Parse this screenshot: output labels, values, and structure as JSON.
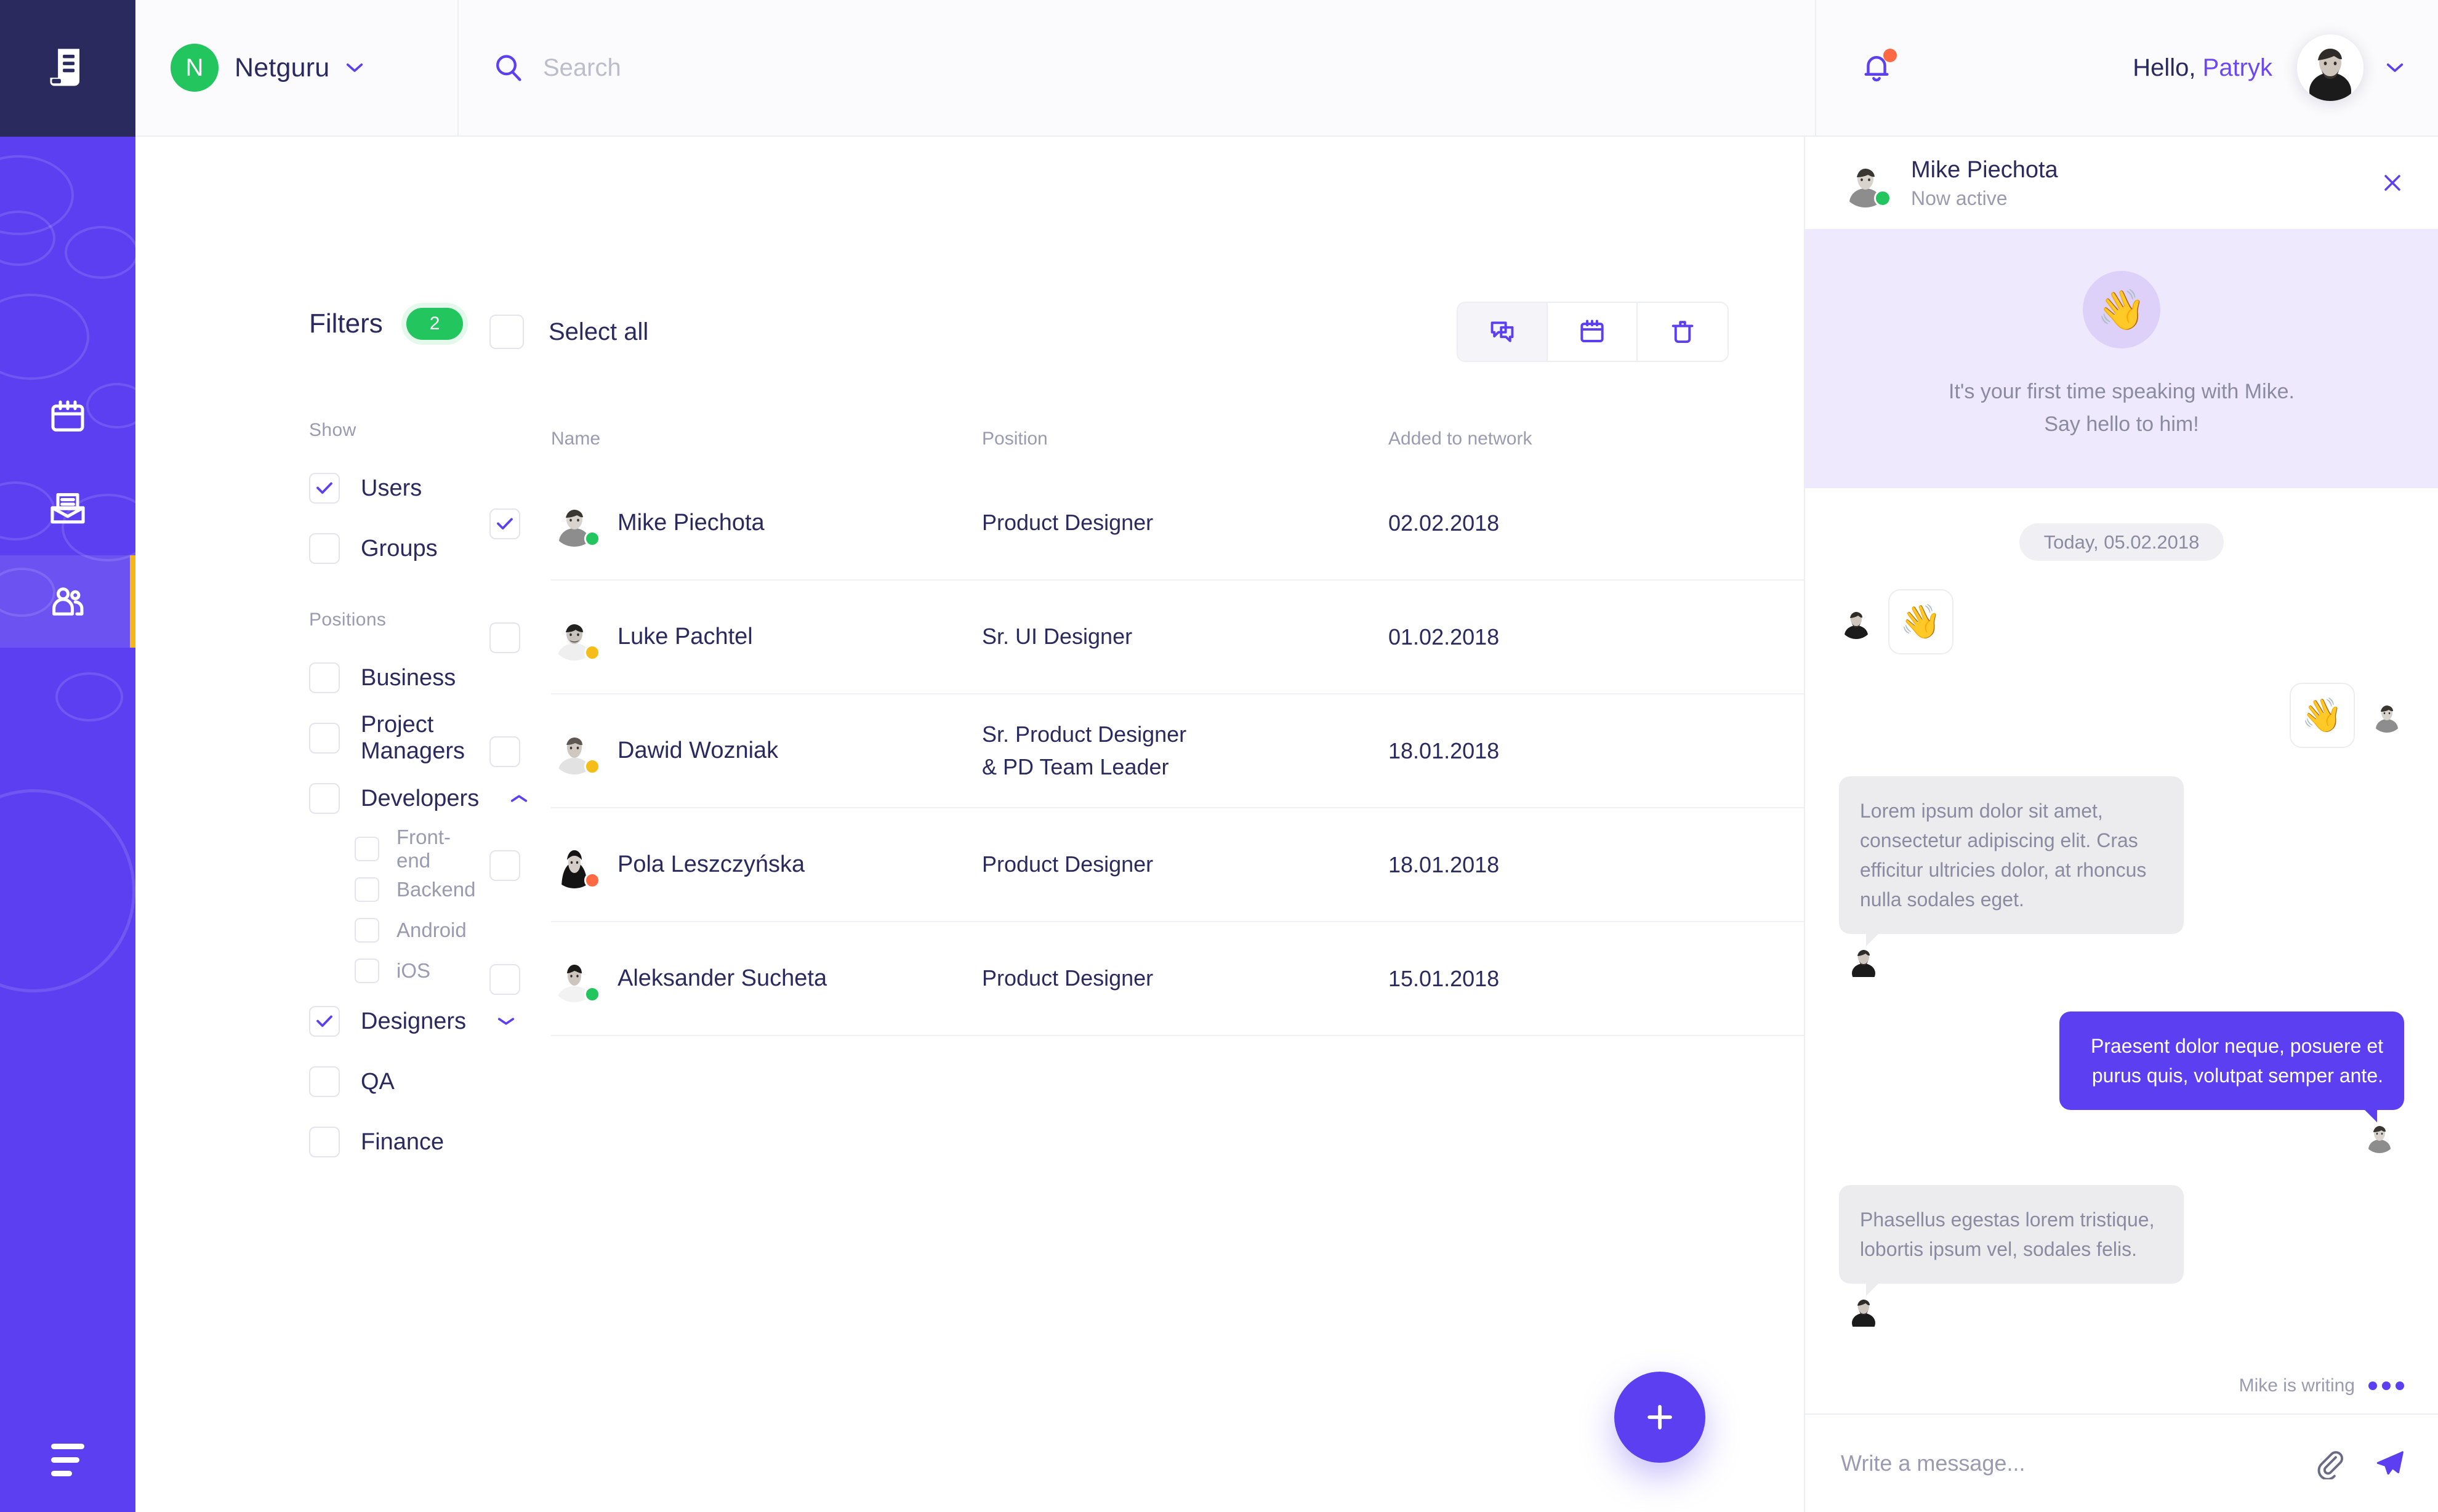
{
  "rail": {
    "logo_icon": "receipt-icon",
    "items": [
      {
        "icon": "calendar-icon",
        "name": "calendar",
        "active": false
      },
      {
        "icon": "inbox-icon",
        "name": "inbox",
        "active": false
      },
      {
        "icon": "people-icon",
        "name": "people",
        "active": true
      }
    ],
    "menu_icon": "hamburger-menu-icon"
  },
  "header": {
    "brand": {
      "initial": "N",
      "name": "Netguru",
      "chevron": "⌄"
    },
    "search": {
      "value": "",
      "placeholder": "Search",
      "icon": "search-icon"
    },
    "notification": {
      "icon": "bell-icon",
      "has_badge": true,
      "badge_color": "#ff6a45"
    },
    "greeting_prefix": "Hello, ",
    "greeting_name": "Patryk",
    "user_chevron": "⌄"
  },
  "filters": {
    "title": "Filters",
    "count": "2",
    "groups": [
      {
        "label": "Show",
        "items": [
          {
            "label": "Users",
            "checked": true,
            "sub": false
          },
          {
            "label": "Groups",
            "checked": false,
            "sub": false
          }
        ]
      },
      {
        "label": "Positions",
        "items": [
          {
            "label": "Business",
            "checked": false,
            "sub": false
          },
          {
            "label": "Project Managers",
            "checked": false,
            "sub": false
          },
          {
            "label": "Developers",
            "checked": false,
            "sub": false,
            "caret": "up"
          },
          {
            "label": "Front-end",
            "checked": false,
            "sub": true
          },
          {
            "label": "Backend",
            "checked": false,
            "sub": true
          },
          {
            "label": "Android",
            "checked": false,
            "sub": true
          },
          {
            "label": "iOS",
            "checked": false,
            "sub": true
          },
          {
            "label": "Designers",
            "checked": true,
            "sub": false,
            "caret": "down"
          },
          {
            "label": "QA",
            "checked": false,
            "sub": false
          },
          {
            "label": "Finance",
            "checked": false,
            "sub": false
          }
        ]
      }
    ]
  },
  "table": {
    "select_all_label": "Select all",
    "select_all_checked": false,
    "tools": [
      {
        "name": "chat-tool",
        "icon": "chat-bubbles-icon",
        "active": true
      },
      {
        "name": "calendar-tool",
        "icon": "calendar-icon",
        "active": false
      },
      {
        "name": "delete-tool",
        "icon": "trash-icon",
        "active": false
      }
    ],
    "columns": [
      "Name",
      "Position",
      "Added to network"
    ],
    "rows": [
      {
        "name": "Mike Piechota",
        "position": "Product Designer",
        "date": "02.02.2018",
        "checked": true,
        "status": "#22c55e"
      },
      {
        "name": "Luke Pachtel",
        "position": "Sr. UI Designer",
        "date": "01.02.2018",
        "checked": false,
        "status": "#f5bd17"
      },
      {
        "name": "Dawid Wozniak",
        "position": "Sr. Product Designer\n& PD Team Leader",
        "date": "18.01.2018",
        "checked": false,
        "status": "#f5bd17"
      },
      {
        "name": "Pola Leszczyńska",
        "position": "Product Designer",
        "date": "18.01.2018",
        "checked": false,
        "status": "#ff6a45"
      },
      {
        "name": "Aleksander Sucheta",
        "position": "Product Designer",
        "date": "15.01.2018",
        "checked": false,
        "status": "#22c55e"
      }
    ],
    "fab_icon": "plus-icon"
  },
  "chat": {
    "contact_name": "Mike Piechota",
    "contact_status": "Now active",
    "close_icon": "close-icon",
    "intro": {
      "emoji": "👋",
      "line1": "It's your first time speaking with Mike.",
      "line2": "Say hello to him!"
    },
    "day_divider": "Today, 05.02.2018",
    "messages": [
      {
        "side": "left",
        "type": "emoji",
        "text": "👋"
      },
      {
        "side": "right",
        "type": "emoji",
        "text": "👋"
      },
      {
        "side": "left",
        "type": "text",
        "text": "Lorem ipsum dolor sit amet, consectetur adipiscing elit. Cras efficitur ultricies dolor, at rhoncus nulla sodales eget."
      },
      {
        "side": "right",
        "type": "text",
        "text": "Praesent dolor neque, posuere et purus quis, volutpat semper ante."
      },
      {
        "side": "left",
        "type": "text",
        "text": "Phasellus egestas lorem tristique, lobortis ipsum vel, sodales felis."
      }
    ],
    "typing_text": "Mike is writing",
    "composer": {
      "value": "",
      "placeholder": "Write a message...",
      "attach_icon": "paperclip-icon",
      "send_icon": "send-icon"
    }
  },
  "colors": {
    "brand_purple": "#5b3ff0",
    "deep_navy": "#2b2a5e",
    "green": "#22c55e",
    "amber": "#f5b717",
    "orange": "#ff6a45",
    "lilac_bg": "#efe9fd"
  }
}
